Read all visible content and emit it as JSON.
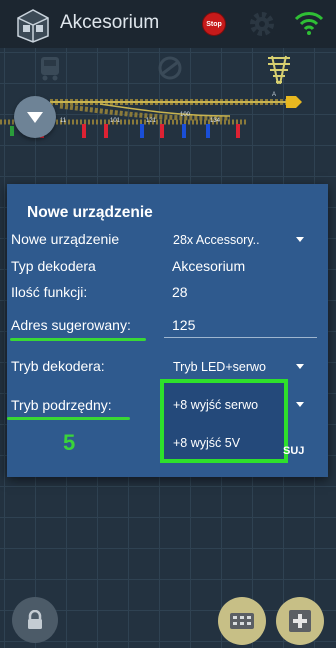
{
  "app": {
    "title": "Akcesorium"
  },
  "header": {
    "stop_label": "Stop"
  },
  "track": {
    "addresses": [
      "11",
      "101",
      "121",
      "100",
      "134"
    ],
    "marker": "A"
  },
  "dialog": {
    "title": "Nowe urządzenie",
    "rows": {
      "new_device": {
        "label": "Nowe urządzenie",
        "value": "28x Accessory.."
      },
      "decoder_type": {
        "label": "Typ dekodera",
        "value": "Akcesorium"
      },
      "functions": {
        "label": "Ilość funkcji:",
        "value": "28"
      },
      "address": {
        "label": "Adres sugerowany:",
        "value": "125"
      },
      "decoder_mode": {
        "label": "Tryb dekodera:",
        "value": "Tryb LED+serwo"
      },
      "sub_mode": {
        "label": "Tryb podrzędny:",
        "value": "+8 wyjść serwo"
      }
    },
    "dropdown_options": [
      "+8 wyjść 5V"
    ],
    "partial_button": "SUJ"
  },
  "annotation": {
    "number": "5",
    "color": "#3ad43a"
  },
  "colors": {
    "dialog_bg": "#2f5a8e",
    "highlight": "#2ee02b",
    "stop": "#c61a1a"
  }
}
